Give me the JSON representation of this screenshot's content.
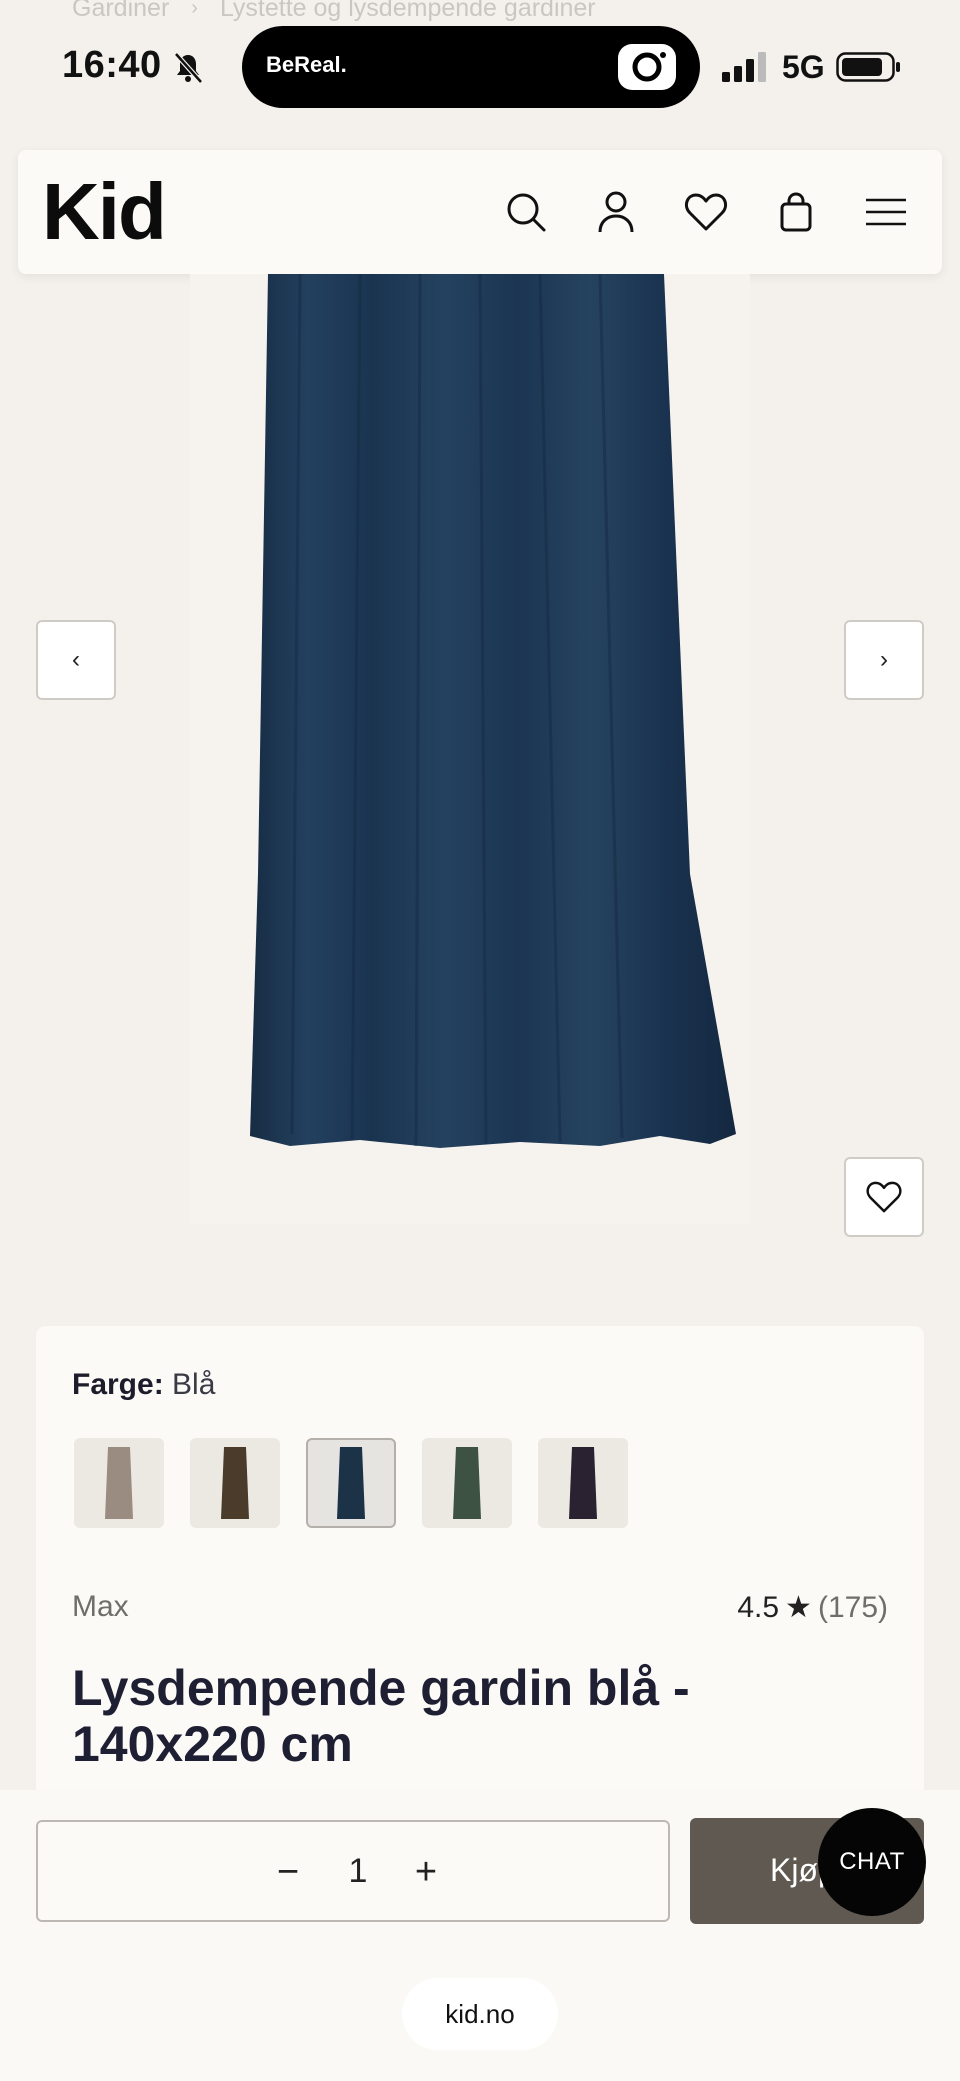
{
  "breadcrumb": {
    "items": [
      "Gardiner",
      "Lystette og lysdempende gardiner"
    ]
  },
  "status_bar": {
    "time": "16:40",
    "island_label": "BeReal.",
    "network": "5G"
  },
  "header": {
    "logo": "Kid",
    "icons": [
      "search-icon",
      "account-icon",
      "heart-icon",
      "bag-icon",
      "menu-icon"
    ]
  },
  "gallery": {
    "prev_label": "‹",
    "next_label": "›"
  },
  "product": {
    "color_label": "Farge:",
    "color_value": "Blå",
    "swatch_colors": [
      "#9a8c80",
      "#4a3b2a",
      "#1c3347",
      "#3d5243",
      "#2a2230"
    ],
    "selected_swatch": 3,
    "brand": "Max",
    "rating": "4.5",
    "rating_star": "★",
    "review_count": "(175)",
    "title": "Lysdempende gardin blå - 140x220 cm"
  },
  "cart": {
    "minus": "−",
    "quantity": "1",
    "plus": "+",
    "buy_label": "Kjøp"
  },
  "chat": {
    "label": "CHAT"
  },
  "browser": {
    "url": "kid.no"
  },
  "colors": {
    "background": "#f4f1ec",
    "curtain": "#1d3550",
    "buy_button": "#5f5952"
  }
}
